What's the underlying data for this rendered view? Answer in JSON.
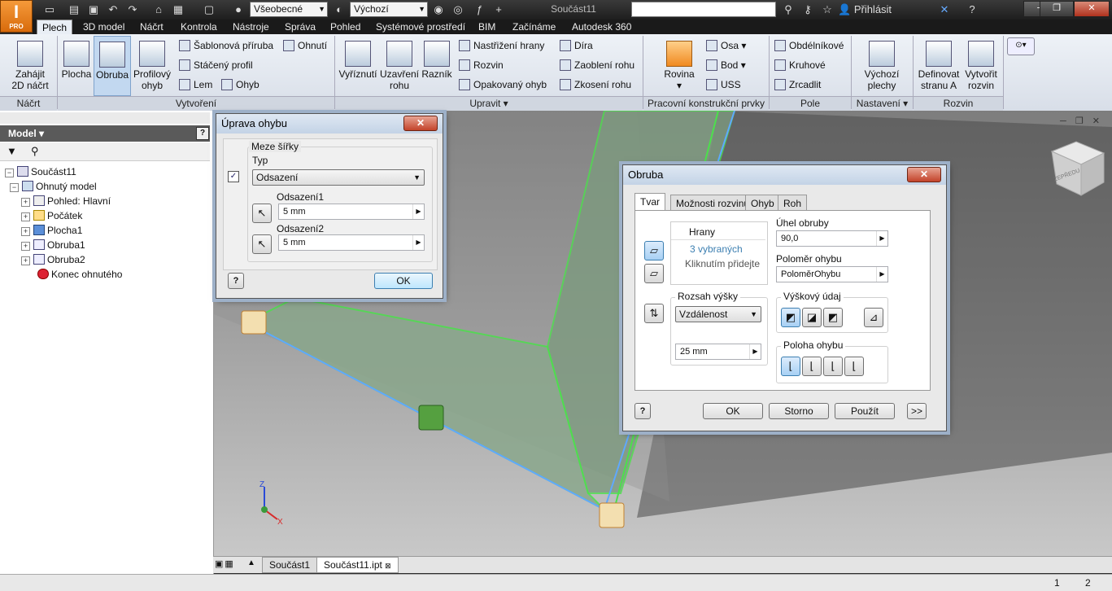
{
  "app": {
    "logo_letter": "I",
    "edition": "PRO"
  },
  "titlebar": {
    "style_combo": "Všeobecné",
    "appearance_combo": "Výchozí",
    "doc_title": "Součást11",
    "login": "Přihlásit"
  },
  "menu": {
    "tabs": [
      "Plech",
      "3D model",
      "Náčrt",
      "Kontrola",
      "Nástroje",
      "Správa",
      "Pohled",
      "Systémové prostředí",
      "BIM",
      "Začínáme",
      "Autodesk 360"
    ]
  },
  "ribbon": {
    "sketch": {
      "start_sketch": "Zahájit\n2D náčrt",
      "label": "Náčrt"
    },
    "create": {
      "face": "Plocha",
      "flange": "Obruba",
      "contour_flange": "Profilový\nohyb",
      "template_flange": "Šablonová příruba",
      "rolled_profile": "Stáčený profil",
      "hem": "Lem",
      "bend": "Ohyb",
      "fold": "Ohnutí",
      "label": "Vytvoření"
    },
    "modify": {
      "cut": "Vyříznutí",
      "corner_seam": "Uzavření\nrohu",
      "punch": "Razník",
      "rip": "Nastřižení hrany",
      "unfold": "Rozvin",
      "refold": "Opakovaný ohyb",
      "hole": "Díra",
      "corner_round": "Zaoblení rohu",
      "corner_chamfer": "Zkosení rohu",
      "label": "Upravit"
    },
    "work": {
      "plane": "Rovina",
      "axis": "Osa",
      "point": "Bod",
      "ucs": "USS",
      "label": "Pracovní konstrukční prvky"
    },
    "pattern": {
      "rect": "Obdélníkové",
      "circ": "Kruhové",
      "mirror": "Zrcadlit",
      "label": "Pole"
    },
    "setup": {
      "defaults": "Výchozí\nplechy",
      "label": "Nastavení"
    },
    "flat": {
      "define_a": "Definovat\nstranu A",
      "create_flat": "Vytvořit\nrozvin",
      "label": "Rozvin"
    }
  },
  "browser": {
    "header": "Model",
    "items": [
      {
        "label": "Součást11",
        "level": 0
      },
      {
        "label": "Ohnutý model",
        "level": 1
      },
      {
        "label": "Pohled: Hlavní",
        "level": 2
      },
      {
        "label": "Počátek",
        "level": 2
      },
      {
        "label": "Plocha1",
        "level": 2
      },
      {
        "label": "Obruba1",
        "level": 2
      },
      {
        "label": "Obruba2",
        "level": 2
      },
      {
        "label": "Konec ohnutého",
        "level": 2
      }
    ]
  },
  "viewcube": {
    "face": "ZEPŘEDU"
  },
  "doctabs": [
    "Součást1",
    "Součást11.ipt"
  ],
  "status": {
    "count1": "1",
    "count2": "2"
  },
  "dlg_bend": {
    "title": "Úprava ohybu",
    "group": "Meze šířky",
    "type_label": "Typ",
    "type_value": "Odsazení",
    "offset1_label": "Odsazení1",
    "offset1_value": "5 mm",
    "offset2_label": "Odsazení2",
    "offset2_value": "5 mm",
    "ok": "OK"
  },
  "dlg_flange": {
    "title": "Obruba",
    "tabs": [
      "Tvar",
      "Možnosti rozvinu",
      "Ohyb",
      "Roh"
    ],
    "edges_header": "Hrany",
    "edges_selected": "3 vybraných",
    "edges_hint": "Kliknutím přidejte",
    "angle_label": "Úhel obruby",
    "angle_value": "90,0",
    "radius_label": "Poloměr ohybu",
    "radius_value": "PoloměrOhybu",
    "extent_label": "Rozsah výšky",
    "extent_value": "Vzdálenost",
    "distance_value": "25 mm",
    "datum_label": "Výškový údaj",
    "position_label": "Poloha ohybu",
    "ok": "OK",
    "cancel": "Storno",
    "apply": "Použít",
    "more": ">>"
  }
}
